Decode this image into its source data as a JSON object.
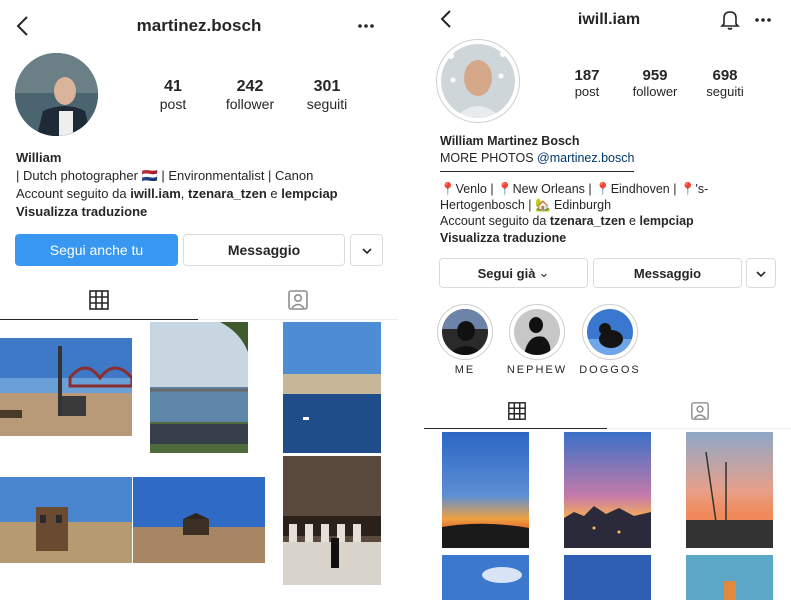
{
  "left": {
    "header": {
      "username": "martinez.bosch"
    },
    "stats": [
      {
        "value": "41",
        "label": "post"
      },
      {
        "value": "242",
        "label": "follower"
      },
      {
        "value": "301",
        "label": "seguiti"
      }
    ],
    "bio": {
      "name": "William",
      "line1_prefix": "| Dutch photographer",
      "line1_flag": "🇳🇱",
      "line1_suffix": "| Environmentalist | Canon",
      "followed_prefix": "Account seguito da",
      "followed_user1": "iwill.iam",
      "followed_sep": ",",
      "followed_user2": "tzenara_tzen",
      "followed_and": "e",
      "followed_user3": "lempciap",
      "translate": "Visualizza traduzione"
    },
    "buttons": {
      "follow": "Segui anche tu",
      "message": "Messaggio"
    },
    "icons": {
      "back": "back-chevron-icon",
      "more": "more-dots-icon",
      "dropdown": "chevron-down-icon",
      "grid": "grid-icon",
      "tagged": "tagged-person-icon"
    }
  },
  "right": {
    "header": {
      "username": "iwill.iam"
    },
    "stats": [
      {
        "value": "187",
        "label": "post"
      },
      {
        "value": "959",
        "label": "follower"
      },
      {
        "value": "698",
        "label": "seguiti"
      }
    ],
    "bio": {
      "name": "William Martinez Bosch",
      "more_prefix": "MORE PHOTOS",
      "more_link": "@martinez.bosch",
      "loc1": "Venlo |",
      "loc2": "New Orleans |",
      "loc3": "Eindhoven |",
      "loc4": "'s-",
      "loc5": "Hertogenbosch |",
      "loc6": "Edinburgh",
      "pin": "📍",
      "house": "🏡",
      "followed_prefix": "Account seguito da",
      "followed_user1": "tzenara_tzen",
      "followed_and": "e",
      "followed_user2": "lempciap",
      "translate": "Visualizza traduzione"
    },
    "buttons": {
      "following": "Segui già",
      "following_caret": "⌄",
      "message": "Messaggio"
    },
    "highlights": [
      {
        "label": "ME"
      },
      {
        "label": "NEPHEW"
      },
      {
        "label": "DOGGOS"
      }
    ],
    "icons": {
      "back": "back-chevron-icon",
      "bell": "bell-icon",
      "more": "more-dots-icon",
      "dropdown": "chevron-down-icon",
      "grid": "grid-icon",
      "tagged": "tagged-person-icon"
    }
  },
  "colors": {
    "accent_blue": "#3897f0",
    "link": "#00376b",
    "border": "#dbdbdb",
    "text": "#262626"
  }
}
